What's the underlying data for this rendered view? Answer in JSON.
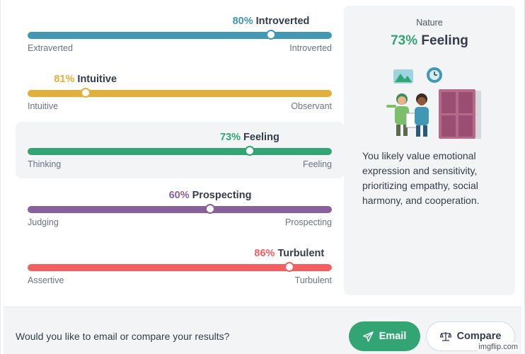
{
  "traits": [
    {
      "pct": "80%",
      "name": "Introverted",
      "left": "Extraverted",
      "right": "Introverted",
      "color": "#4298b4",
      "value": 0.8,
      "side": "right",
      "active": false
    },
    {
      "pct": "81%",
      "name": "Intuitive",
      "left": "Intuitive",
      "right": "Observant",
      "color": "#e4ae3a",
      "value": 0.81,
      "side": "left",
      "active": false
    },
    {
      "pct": "73%",
      "name": "Feeling",
      "left": "Thinking",
      "right": "Feeling",
      "color": "#33a474",
      "value": 0.73,
      "side": "right",
      "active": true
    },
    {
      "pct": "60%",
      "name": "Prospecting",
      "left": "Judging",
      "right": "Prospecting",
      "color": "#88619a",
      "value": 0.6,
      "side": "right",
      "active": false
    },
    {
      "pct": "86%",
      "name": "Turbulent",
      "left": "Assertive",
      "right": "Turbulent",
      "color": "#f25e62",
      "value": 0.86,
      "side": "right",
      "active": false
    }
  ],
  "card": {
    "kicker": "Nature",
    "title_pct": "73%",
    "title_name": "Feeling",
    "description": "You likely value emotional expression and sensitivity, prioritizing empathy, social harmony, and cooperation."
  },
  "footer": {
    "question": "Would you like to email or compare your results?",
    "email_label": "Email",
    "compare_label": "Compare"
  },
  "watermark": "imgflip.com",
  "colors": {
    "accent": "#33a474",
    "panel": "#f3f4f6",
    "text": "#343c4b"
  }
}
